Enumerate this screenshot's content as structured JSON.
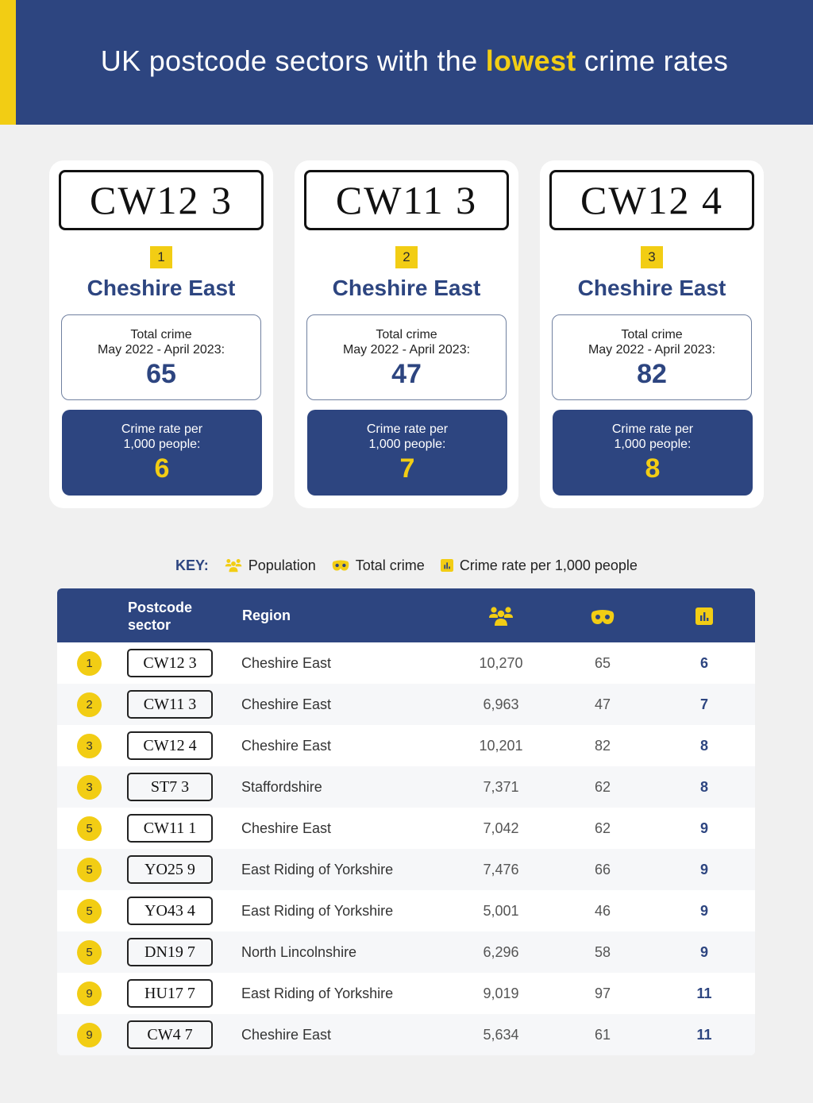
{
  "header": {
    "title_before": "UK postcode sectors with the ",
    "title_highlight": "lowest",
    "title_after": " crime rates"
  },
  "colors": {
    "navy": "#2d4580",
    "yellow": "#f2cd14",
    "background": "#f0f0f0"
  },
  "cards": [
    {
      "postcode": "CW12 3",
      "rank": "1",
      "region": "Cheshire East",
      "total_label_1": "Total crime",
      "total_label_2": "May 2022 - April 2023:",
      "total_value": "65",
      "rate_label_1": "Crime rate per",
      "rate_label_2": "1,000 people:",
      "rate_value": "6"
    },
    {
      "postcode": "CW11 3",
      "rank": "2",
      "region": "Cheshire East",
      "total_label_1": "Total crime",
      "total_label_2": "May 2022 - April 2023:",
      "total_value": "47",
      "rate_label_1": "Crime rate per",
      "rate_label_2": "1,000 people:",
      "rate_value": "7"
    },
    {
      "postcode": "CW12 4",
      "rank": "3",
      "region": "Cheshire East",
      "total_label_1": "Total crime",
      "total_label_2": "May 2022 - April 2023:",
      "total_value": "82",
      "rate_label_1": "Crime rate per",
      "rate_label_2": "1,000 people:",
      "rate_value": "8"
    }
  ],
  "key": {
    "label": "KEY:",
    "items": [
      {
        "icon": "people-icon",
        "label": "Population"
      },
      {
        "icon": "mask-icon",
        "label": "Total crime"
      },
      {
        "icon": "bar-chart-icon",
        "label": "Crime rate per 1,000 people"
      }
    ]
  },
  "table": {
    "headers": {
      "postcode_line1": "Postcode",
      "postcode_line2": "sector",
      "region": "Region",
      "population_icon": "people-icon",
      "total_crime_icon": "mask-icon",
      "rate_icon": "bar-chart-icon"
    },
    "rows": [
      {
        "rank": "1",
        "postcode": "CW12 3",
        "region": "Cheshire East",
        "population": "10,270",
        "total_crime": "65",
        "rate": "6"
      },
      {
        "rank": "2",
        "postcode": "CW11 3",
        "region": "Cheshire East",
        "population": "6,963",
        "total_crime": "47",
        "rate": "7"
      },
      {
        "rank": "3",
        "postcode": "CW12 4",
        "region": "Cheshire East",
        "population": "10,201",
        "total_crime": "82",
        "rate": "8"
      },
      {
        "rank": "3",
        "postcode": "ST7 3",
        "region": "Staffordshire",
        "population": "7,371",
        "total_crime": "62",
        "rate": "8"
      },
      {
        "rank": "5",
        "postcode": "CW11 1",
        "region": "Cheshire East",
        "population": "7,042",
        "total_crime": "62",
        "rate": "9"
      },
      {
        "rank": "5",
        "postcode": "YO25 9",
        "region": "East Riding of Yorkshire",
        "population": "7,476",
        "total_crime": "66",
        "rate": "9"
      },
      {
        "rank": "5",
        "postcode": "YO43 4",
        "region": "East Riding of Yorkshire",
        "population": "5,001",
        "total_crime": "46",
        "rate": "9"
      },
      {
        "rank": "5",
        "postcode": "DN19 7",
        "region": "North Lincolnshire",
        "population": "6,296",
        "total_crime": "58",
        "rate": "9"
      },
      {
        "rank": "9",
        "postcode": "HU17 7",
        "region": "East Riding of Yorkshire",
        "population": "9,019",
        "total_crime": "97",
        "rate": "11"
      },
      {
        "rank": "9",
        "postcode": "CW4 7",
        "region": "Cheshire East",
        "population": "5,634",
        "total_crime": "61",
        "rate": "11"
      }
    ]
  }
}
